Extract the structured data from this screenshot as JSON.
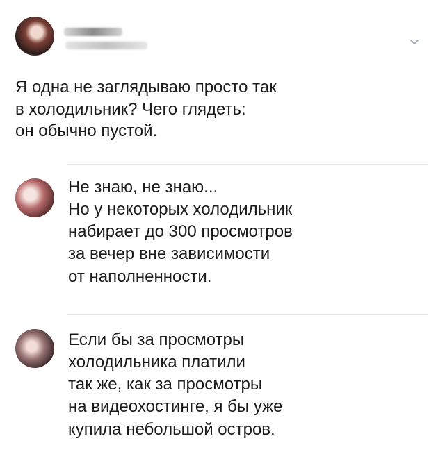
{
  "post": {
    "text": "Я одна не заглядываю просто так\nв холодильник? Чего глядеть:\nон обычно пустой."
  },
  "replies": [
    {
      "text": "Не знаю, не знаю...\nНо у некоторых холодильник\nнабирает до 300 просмотров\nза вечер вне зависимости\nот наполненности."
    },
    {
      "text": "Если бы за просмотры\nхолодильника платили\nтак же, как за просмотры\nна видеохостинге, я бы уже\nкупила небольшой остров."
    }
  ],
  "icons": {
    "menu": "chevron-down-icon"
  },
  "colors": {
    "background": "#ffffff",
    "text": "#1c1c1c",
    "divider": "#e8ebee",
    "chevron": "#9aa3ad"
  }
}
